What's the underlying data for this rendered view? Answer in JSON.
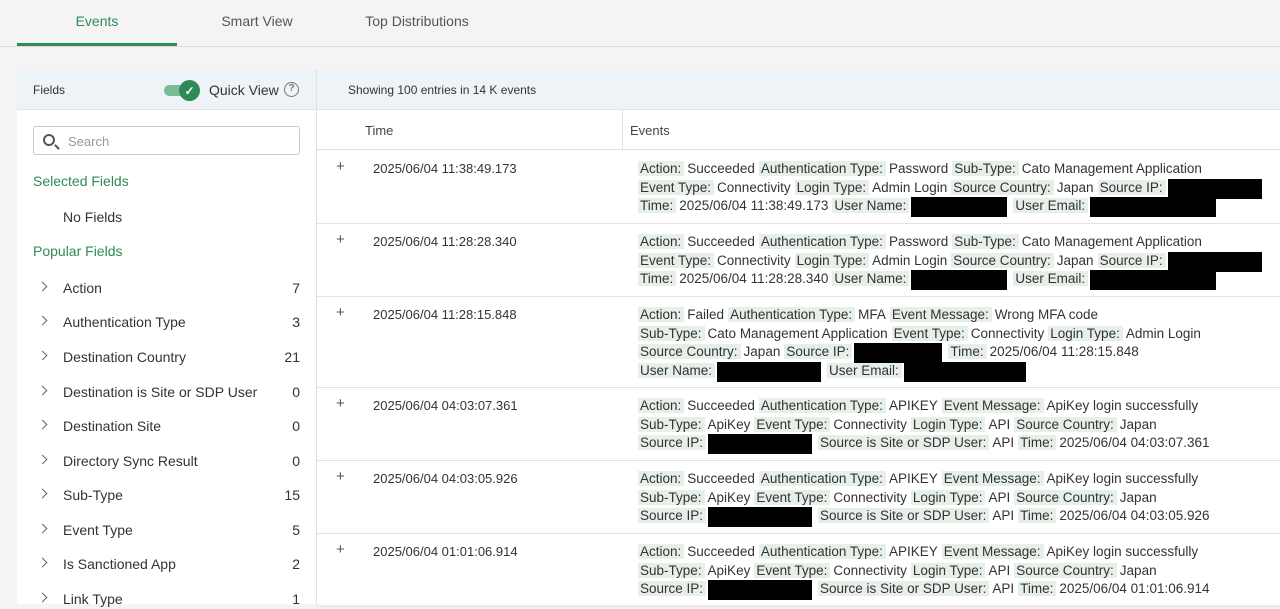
{
  "tabs": [
    {
      "label": "Events",
      "active": true
    },
    {
      "label": "Smart View",
      "active": false
    },
    {
      "label": "Top Distributions",
      "active": false
    }
  ],
  "sidebar": {
    "fields_label": "Fields",
    "quick_view_label": "Quick View",
    "quick_view_on": true,
    "search_placeholder": "Search",
    "selected_title": "Selected Fields",
    "no_fields": "No Fields",
    "popular_title": "Popular Fields",
    "fields": [
      {
        "name": "Action",
        "count": "7"
      },
      {
        "name": "Authentication Type",
        "count": "3"
      },
      {
        "name": "Destination Country",
        "count": "21"
      },
      {
        "name": "Destination is Site or SDP User",
        "count": "0"
      },
      {
        "name": "Destination Site",
        "count": "0"
      },
      {
        "name": "Directory Sync Result",
        "count": "0"
      },
      {
        "name": "Sub-Type",
        "count": "15"
      },
      {
        "name": "Event Type",
        "count": "5"
      },
      {
        "name": "Is Sanctioned App",
        "count": "2"
      },
      {
        "name": "Link Type",
        "count": "1"
      }
    ]
  },
  "main": {
    "summary": "Showing 100 entries in 14 K events",
    "col_time": "Time",
    "col_events": "Events",
    "plus_glyph": "+",
    "rows": [
      {
        "time": "2025/06/04 11:38:49.173",
        "lines": [
          [
            {
              "k": "Action:",
              "v": "Succeeded"
            },
            {
              "k": "Authentication Type:",
              "v": "Password"
            },
            {
              "k": "Sub-Type:",
              "v": "Cato Management Application"
            }
          ],
          [
            {
              "k": "Event Type:",
              "v": "Connectivity"
            },
            {
              "k": "Login Type:",
              "v": "Admin Login"
            },
            {
              "k": "Source Country:",
              "v": "Japan"
            },
            {
              "k": "Source IP:",
              "redact": 94
            }
          ],
          [
            {
              "k": "Time:",
              "v": "2025/06/04 11:38:49.173"
            },
            {
              "k": "User Name:",
              "redact": 96
            },
            {
              "k": "User Email:",
              "redact": 126
            }
          ]
        ]
      },
      {
        "time": "2025/06/04 11:28:28.340",
        "lines": [
          [
            {
              "k": "Action:",
              "v": "Succeeded"
            },
            {
              "k": "Authentication Type:",
              "v": "Password"
            },
            {
              "k": "Sub-Type:",
              "v": "Cato Management Application"
            }
          ],
          [
            {
              "k": "Event Type:",
              "v": "Connectivity"
            },
            {
              "k": "Login Type:",
              "v": "Admin Login"
            },
            {
              "k": "Source Country:",
              "v": "Japan"
            },
            {
              "k": "Source IP:",
              "redact": 94
            }
          ],
          [
            {
              "k": "Time:",
              "v": "2025/06/04 11:28:28.340"
            },
            {
              "k": "User Name:",
              "redact": 96
            },
            {
              "k": "User Email:",
              "redact": 126
            }
          ]
        ]
      },
      {
        "time": "2025/06/04 11:28:15.848",
        "lines": [
          [
            {
              "k": "Action:",
              "v": "Failed"
            },
            {
              "k": "Authentication Type:",
              "v": "MFA"
            },
            {
              "k": "Event Message:",
              "v": "Wrong MFA code"
            }
          ],
          [
            {
              "k": "Sub-Type:",
              "v": "Cato Management Application"
            },
            {
              "k": "Event Type:",
              "v": "Connectivity"
            },
            {
              "k": "Login Type:",
              "v": "Admin Login"
            }
          ],
          [
            {
              "k": "Source Country:",
              "v": "Japan"
            },
            {
              "k": "Source IP:",
              "redact": 88
            },
            {
              "k": "Time:",
              "v": "2025/06/04 11:28:15.848"
            }
          ],
          [
            {
              "k": "User Name:",
              "redact": 104
            },
            {
              "k": "User Email:",
              "redact": 122
            }
          ]
        ]
      },
      {
        "time": "2025/06/04 04:03:07.361",
        "lines": [
          [
            {
              "k": "Action:",
              "v": "Succeeded"
            },
            {
              "k": "Authentication Type:",
              "v": "APIKEY"
            },
            {
              "k": "Event Message:",
              "v": "ApiKey login successfully"
            }
          ],
          [
            {
              "k": "Sub-Type:",
              "v": "ApiKey"
            },
            {
              "k": "Event Type:",
              "v": "Connectivity"
            },
            {
              "k": "Login Type:",
              "v": "API"
            },
            {
              "k": "Source Country:",
              "v": "Japan"
            }
          ],
          [
            {
              "k": "Source IP:",
              "redact": 104
            },
            {
              "k": "Source is Site or SDP User:",
              "v": "API"
            },
            {
              "k": "Time:",
              "v": "2025/06/04 04:03:07.361"
            }
          ]
        ]
      },
      {
        "time": "2025/06/04 04:03:05.926",
        "lines": [
          [
            {
              "k": "Action:",
              "v": "Succeeded"
            },
            {
              "k": "Authentication Type:",
              "v": "APIKEY"
            },
            {
              "k": "Event Message:",
              "v": "ApiKey login successfully"
            }
          ],
          [
            {
              "k": "Sub-Type:",
              "v": "ApiKey"
            },
            {
              "k": "Event Type:",
              "v": "Connectivity"
            },
            {
              "k": "Login Type:",
              "v": "API"
            },
            {
              "k": "Source Country:",
              "v": "Japan"
            }
          ],
          [
            {
              "k": "Source IP:",
              "redact": 104
            },
            {
              "k": "Source is Site or SDP User:",
              "v": "API"
            },
            {
              "k": "Time:",
              "v": "2025/06/04 04:03:05.926"
            }
          ]
        ]
      },
      {
        "time": "2025/06/04 01:01:06.914",
        "lines": [
          [
            {
              "k": "Action:",
              "v": "Succeeded"
            },
            {
              "k": "Authentication Type:",
              "v": "APIKEY"
            },
            {
              "k": "Event Message:",
              "v": "ApiKey login successfully"
            }
          ],
          [
            {
              "k": "Sub-Type:",
              "v": "ApiKey"
            },
            {
              "k": "Event Type:",
              "v": "Connectivity"
            },
            {
              "k": "Login Type:",
              "v": "API"
            },
            {
              "k": "Source Country:",
              "v": "Japan"
            }
          ],
          [
            {
              "k": "Source IP:",
              "redact": 104
            },
            {
              "k": "Source is Site or SDP User:",
              "v": "API"
            },
            {
              "k": "Time:",
              "v": "2025/06/04 01:01:06.914"
            }
          ]
        ]
      }
    ]
  },
  "colors": {
    "accent": "#2e8b57",
    "key_bg": "#e6efe8",
    "header_bg": "#eef3f8"
  }
}
